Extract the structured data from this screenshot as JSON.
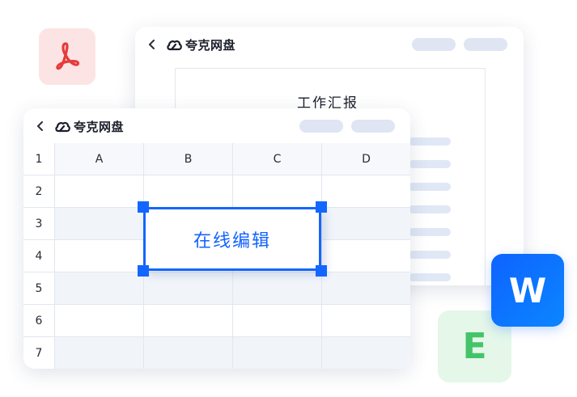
{
  "colors": {
    "accent": "#1366ff",
    "pdf": "#e63b3b",
    "excel": "#44c468",
    "word": "#0e63ff"
  },
  "badges": {
    "pdf": {
      "icon": "pdf-icon"
    },
    "excel": {
      "letter": "E",
      "icon": "excel-file-icon"
    },
    "word": {
      "letter": "W",
      "icon": "word-file-icon"
    }
  },
  "back_window": {
    "app_name": "夸克网盘",
    "document_title": "工作汇报"
  },
  "front_window": {
    "app_name": "夸克网盘",
    "columns": [
      "A",
      "B",
      "C",
      "D"
    ],
    "rows": [
      "1",
      "2",
      "3",
      "4",
      "5",
      "6",
      "7"
    ],
    "selection_label": "在线编辑"
  }
}
